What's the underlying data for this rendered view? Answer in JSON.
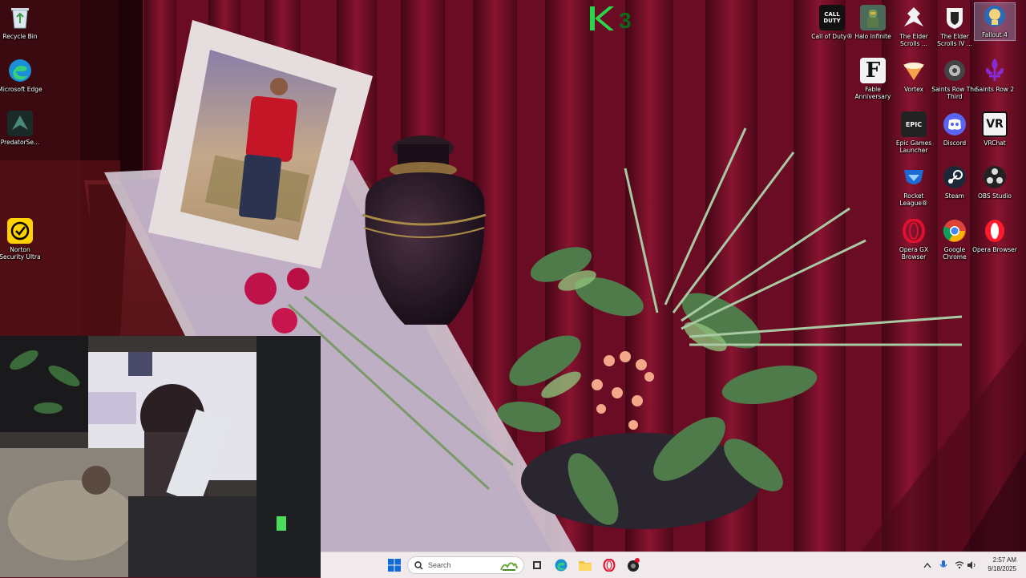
{
  "desktop": {
    "icons_left": [
      {
        "label": "Recycle Bin",
        "icon": "recycle-bin-icon"
      },
      {
        "label": "Microsoft Edge",
        "icon": "edge-icon"
      },
      {
        "label": "PredatorSe...",
        "icon": "predator-sense-icon"
      },
      {
        "label": "Norton Security Ultra",
        "icon": "norton-icon"
      }
    ],
    "icons_right": [
      {
        "label": "Call of Duty®",
        "icon": "call-of-duty-icon",
        "glyph": "CALL\nDUTY"
      },
      {
        "label": "Halo Infinite",
        "icon": "halo-icon"
      },
      {
        "label": "The Elder Scrolls ...",
        "icon": "elder-scrolls-skyrim-icon"
      },
      {
        "label": "The Elder Scrolls IV ...",
        "icon": "elder-scrolls-oblivion-icon"
      },
      {
        "label": "Fallout 4",
        "icon": "fallout-icon"
      },
      {
        "label": "Fable Anniversary",
        "icon": "fable-icon",
        "glyph": "F"
      },
      {
        "label": "Vortex",
        "icon": "vortex-icon"
      },
      {
        "label": "Saints Row The Third",
        "icon": "saints-row-third-icon"
      },
      {
        "label": "Saints Row 2",
        "icon": "saints-row-2-icon"
      },
      {
        "label": "Epic Games Launcher",
        "icon": "epic-games-icon",
        "glyph": "EPIC"
      },
      {
        "label": "Discord",
        "icon": "discord-icon"
      },
      {
        "label": "VRChat",
        "icon": "vrchat-icon",
        "glyph": "VR"
      },
      {
        "label": "Rocket League®",
        "icon": "rocket-league-icon"
      },
      {
        "label": "Steam",
        "icon": "steam-icon"
      },
      {
        "label": "OBS Studio",
        "icon": "obs-icon"
      },
      {
        "label": "Opera GX Browser",
        "icon": "opera-gx-icon"
      },
      {
        "label": "Google Chrome",
        "icon": "chrome-icon"
      },
      {
        "label": "Opera Browser",
        "icon": "opera-icon"
      }
    ]
  },
  "logo": {
    "text": "K3"
  },
  "taskbar": {
    "search_placeholder": "Search",
    "time": "2:57 AM",
    "date": "9/18/2025",
    "pinned": [
      "start-button",
      "search-widget",
      "task-view",
      "edge",
      "file-explorer",
      "opera",
      "app"
    ]
  },
  "colors": {
    "taskbar_bg": "#f0eaec",
    "curtain": "#7a1028",
    "logo_green": "#29d84a",
    "windows_blue": "#0f6cd6"
  }
}
